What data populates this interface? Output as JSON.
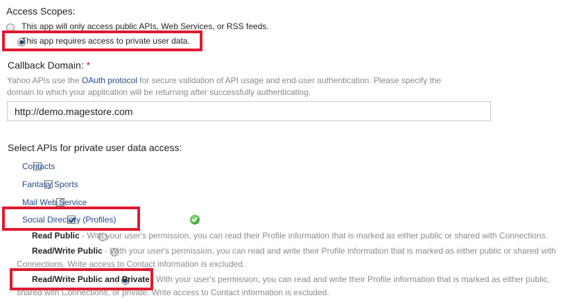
{
  "access_scopes": {
    "heading": "Access Scopes:",
    "option_public": "This app will only access public APIs, Web Services, or RSS feeds.",
    "option_private": "This app requires access to private user data.",
    "selected": "option_private"
  },
  "callback": {
    "label": "Callback Domain:",
    "required_mark": "*",
    "help_prefix": "Yahoo APIs use the ",
    "help_link": "OAuth protocol",
    "help_line1_suffix": " for secure validation of API usage and end-user authentication. Please specify the",
    "help_line2": "domain to which your application will be returning after successfully authenticating.",
    "value": "http://demo.magestore.com"
  },
  "apis": {
    "heading": "Select APIs for private user data access:",
    "items": [
      {
        "label": "Contacts",
        "checked": false
      },
      {
        "label": "Fantasy Sports",
        "checked": false
      },
      {
        "label": "Mail Web Service",
        "checked": false
      },
      {
        "label": "Social Directory (Profiles)",
        "checked": true
      }
    ]
  },
  "profile_permissions": {
    "read_public": {
      "title": "Read Public",
      "desc": " - With your user's permission, you can read their Profile information that is marked as either public or shared with Connections."
    },
    "read_write_public": {
      "title": "Read/Write Public",
      "desc_line1": " - With your user's permission, you can read and write their Profile information that is marked as either public or shared with",
      "desc_line2": "Connections. Write access to Contact information is excluded."
    },
    "read_write_public_private": {
      "title": "Read/Write Public and Private",
      "desc_line1": "With your user's permission, you can read and write their Profile information that is marked as either public,",
      "desc_line2": "shared with Connections, or private. Write access to Contact information is excluded."
    },
    "selected": "read_write_public_private"
  },
  "colors": {
    "highlight": "#e0192e",
    "link": "#1f4a8a",
    "required": "#e0192e",
    "help_text": "#8a8a8a"
  },
  "icons": {
    "verified": "green-check-circle-icon"
  }
}
